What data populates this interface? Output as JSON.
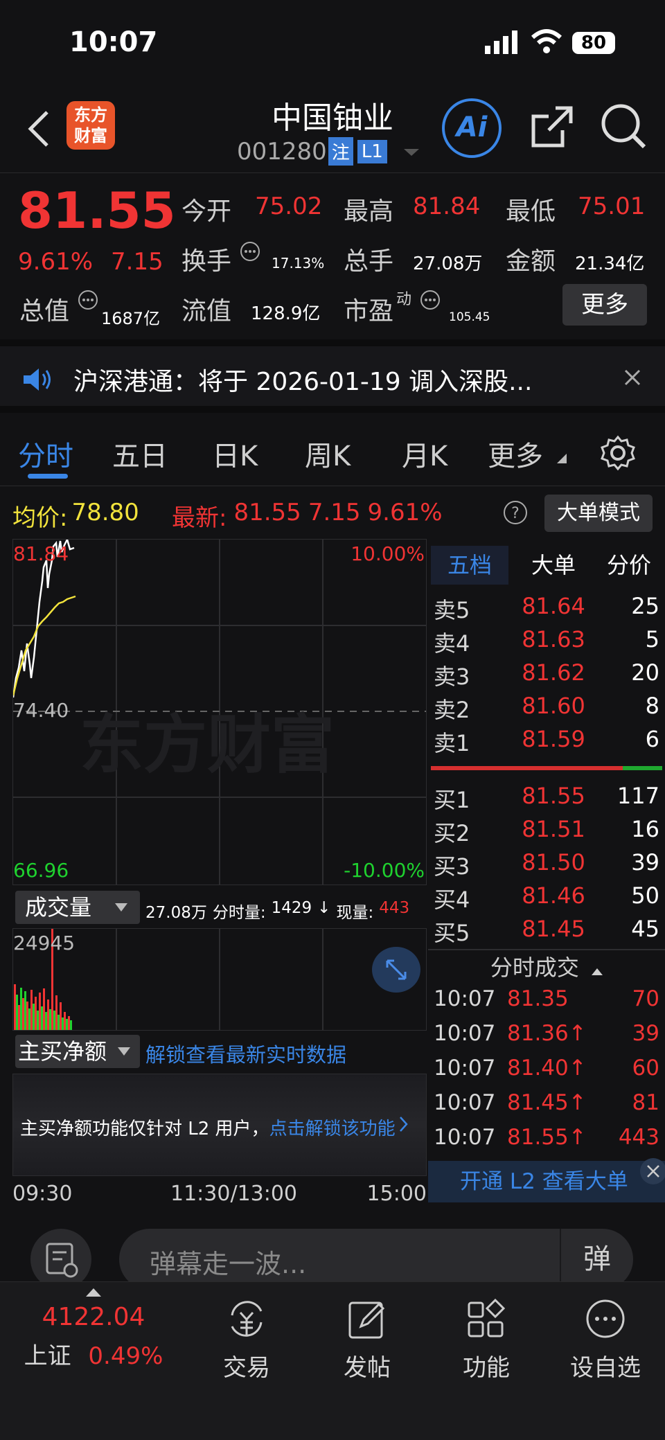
{
  "status": {
    "time": "10:07",
    "battery": "80"
  },
  "header": {
    "logo_line1": "东方",
    "logo_line2": "财富",
    "title": "中国铀业",
    "code": "001280",
    "badge1": "注",
    "badge2": "L1",
    "ai": "Ai"
  },
  "quote": {
    "price": "81.55",
    "pct": "9.61%",
    "chg": "7.15",
    "open_label": "今开",
    "open": "75.02",
    "high_label": "最高",
    "high": "81.84",
    "low_label": "最低",
    "low": "75.01",
    "turnover_label": "换手",
    "turnover": "17.13%",
    "volume_label": "总手",
    "volume": "27.08万",
    "amount_label": "金额",
    "amount": "21.34亿",
    "mktcap_label": "总值",
    "mktcap": "1687亿",
    "float_label": "流值",
    "float": "128.9亿",
    "pe_label": "市盈",
    "pe_sup": "动",
    "pe": "105.45",
    "more": "更多"
  },
  "notice": {
    "text": "沪深港通：将于 2026-01-19 调入深股..."
  },
  "tabs": {
    "t1": "分时",
    "t2": "五日",
    "t3": "日K",
    "t4": "周K",
    "t5": "月K",
    "t6": "更多"
  },
  "infobar": {
    "avg_label": "均价:",
    "avg": "78.80",
    "latest_label": "最新:",
    "latest": "81.55",
    "chg": "7.15",
    "pct": "9.61%",
    "bigmode": "大单模式"
  },
  "chart_labels": {
    "top": "81.84",
    "top_pct": "10.00%",
    "mid": "74.40",
    "bottom": "66.96",
    "bottom_pct": "-10.00%",
    "watermark": "东方财富"
  },
  "volbar": {
    "label": "成交量",
    "total": "27.08万",
    "fenshi_label": "分时量:",
    "fenshi": "1429",
    "arrow": "↓",
    "now_label": "现量:",
    "now": "443",
    "max": "24945"
  },
  "netbar": {
    "label": "主买净额",
    "unlock": "解锁查看最新实时数据"
  },
  "l2box": {
    "text": "主买净额功能仅针对 L2 用户，",
    "link": "点击解锁该功能"
  },
  "timeaxis": {
    "start": "09:30",
    "mid": "11:30/13:00",
    "end": "15:00"
  },
  "book": {
    "tab1": "五档",
    "tab2": "大单",
    "tab3": "分价",
    "asks": [
      {
        "label": "卖5",
        "price": "81.64",
        "qty": "25"
      },
      {
        "label": "卖4",
        "price": "81.63",
        "qty": "5"
      },
      {
        "label": "卖3",
        "price": "81.62",
        "qty": "20"
      },
      {
        "label": "卖2",
        "price": "81.60",
        "qty": "8"
      },
      {
        "label": "卖1",
        "price": "81.59",
        "qty": "6"
      }
    ],
    "bids": [
      {
        "label": "买1",
        "price": "81.55",
        "qty": "117"
      },
      {
        "label": "买2",
        "price": "81.51",
        "qty": "16"
      },
      {
        "label": "买3",
        "price": "81.50",
        "qty": "39"
      },
      {
        "label": "买4",
        "price": "81.46",
        "qty": "50"
      },
      {
        "label": "买5",
        "price": "81.45",
        "qty": "45"
      }
    ],
    "trades_title": "分时成交",
    "trades": [
      {
        "time": "10:07",
        "price": "81.35",
        "vol": "70"
      },
      {
        "time": "10:07",
        "price": "81.36↑",
        "vol": "39"
      },
      {
        "time": "10:07",
        "price": "81.40↑",
        "vol": "60"
      },
      {
        "time": "10:07",
        "price": "81.45↑",
        "vol": "81"
      },
      {
        "time": "10:07",
        "price": "81.55↑",
        "vol": "443"
      }
    ],
    "l2_banner": "开通 L2 查看大单"
  },
  "danmu": {
    "placeholder": "弹幕走一波...",
    "btn": "弹"
  },
  "bottomnav": {
    "index_value": "4122.04",
    "index_name": "上证",
    "index_pct": "0.49%",
    "trade": "交易",
    "post": "发帖",
    "func": "功能",
    "watch": "设自选"
  },
  "colors": {
    "up": "#f03434",
    "down": "#1fd12f",
    "avg": "#f2e33c",
    "accent": "#3a86e6"
  }
}
